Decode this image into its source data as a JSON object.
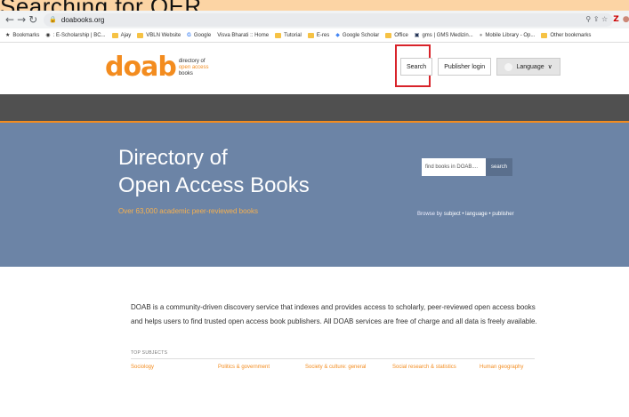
{
  "page_heading": "Searching for OER",
  "browser": {
    "url": "doabooks.org",
    "bookmarks": [
      "Bookmarks",
      ": E-Scholarship | BC...",
      "Ajay",
      "VBLN Website",
      "Google",
      "Visva Bharati :: Home",
      "Tutorial",
      "E-res",
      "Google Scholar",
      "Office",
      "gms | GMS Medizin...",
      "Mobile Library - Op...",
      "Other bookmarks"
    ]
  },
  "header": {
    "logo_mark": "doab",
    "logo_line1": "directory of",
    "logo_line2": "open access",
    "logo_line3": "books",
    "search_label": "Search",
    "publisher_login_label": "Publisher login",
    "language_label": "Language"
  },
  "hero": {
    "title_line1": "Directory of",
    "title_line2": "Open Access Books",
    "subtitle": "Over 63,000 academic peer-reviewed books",
    "search_placeholder": "find books in DOAB....",
    "search_button": "search",
    "browse_prefix": "Browse by",
    "browse_links": "subject • language • publisher"
  },
  "content": {
    "intro": "DOAB is a community-driven discovery service that indexes and provides access to scholarly, peer-reviewed open access books and helps users to find trusted open access book publishers. All DOAB services are free of charge and all data is freely available.",
    "top_subjects_title": "TOP SUBJECTS",
    "subjects": [
      "Sociology",
      "Politics & government",
      "Society & culture: general",
      "Social research & statistics",
      "Human geography"
    ]
  },
  "colors": {
    "accent": "#f38c1f",
    "highlight_box": "#d8232a",
    "hero_bg": "#6c84a6"
  }
}
